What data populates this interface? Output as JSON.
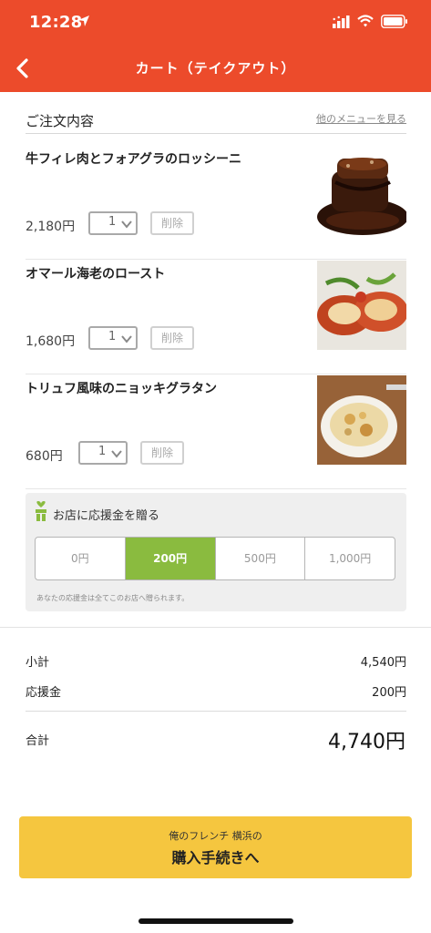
{
  "status_bar": {
    "time": "12:28"
  },
  "nav": {
    "title": "カート（テイクアウト）"
  },
  "order": {
    "heading": "ご注文内容",
    "more_link": "他のメニューを見る",
    "items": [
      {
        "name": "牛フィレ肉とフォアグラのロッシーニ",
        "price": "2,180円",
        "qty": "1",
        "delete_label": "削除"
      },
      {
        "name": "オマール海老のロースト",
        "price": "1,680円",
        "qty": "1",
        "delete_label": "削除"
      },
      {
        "name": "トリュフ風味のニョッキグラタン",
        "price": "680円",
        "qty": "1",
        "delete_label": "削除"
      }
    ]
  },
  "support": {
    "title": "お店に応援金を贈る",
    "options": [
      "0円",
      "200円",
      "500円",
      "1,000円"
    ],
    "selected": "200円",
    "note": "あなたの応援金は全てこのお店へ贈られます。"
  },
  "summary": {
    "subtotal_label": "小計",
    "subtotal_value": "4,540円",
    "support_label": "応援金",
    "support_value": "200円",
    "total_label": "合計",
    "total_value": "4,740円"
  },
  "checkout": {
    "shop_name": "俺のフレンチ 横浜の",
    "label": "購入手続きへ"
  },
  "colors": {
    "header": "#ec4b2b",
    "accent_green": "#8abb3f",
    "checkout_yellow": "#f5c63f"
  }
}
